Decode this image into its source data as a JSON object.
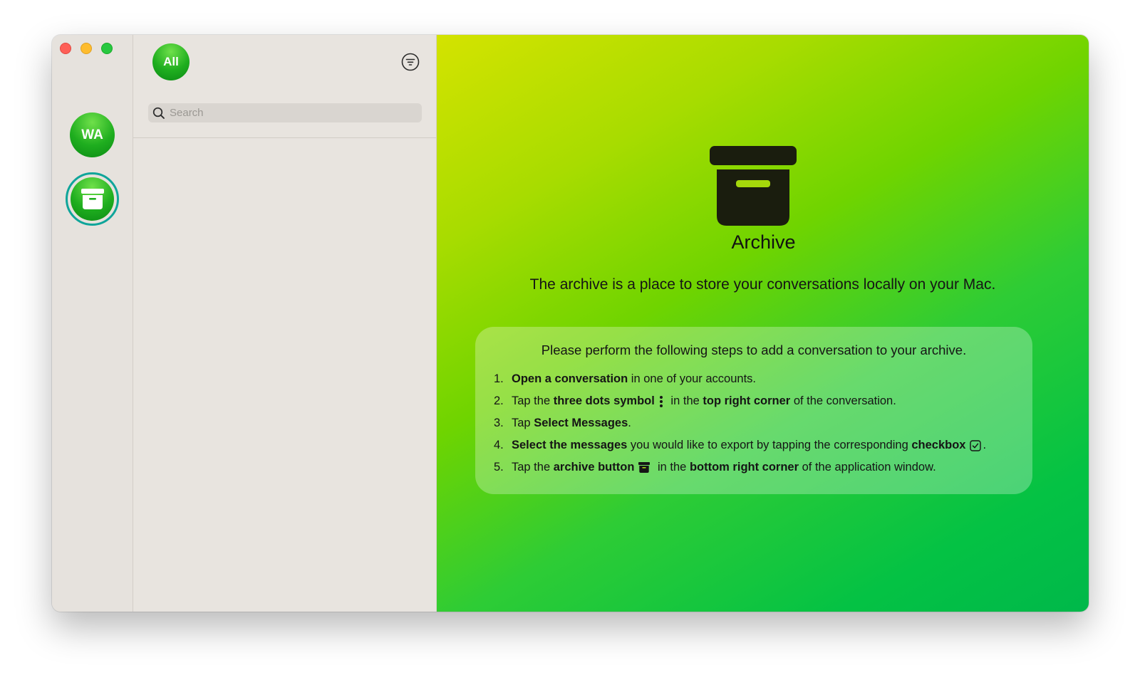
{
  "accounts": {
    "wa_label": "WA"
  },
  "list": {
    "all_label": "All",
    "search_placeholder": "Search"
  },
  "archive": {
    "title": "Archive",
    "subtitle": "The archive is a place to store your conversations locally on your Mac.",
    "steps_heading": "Please perform the following steps to add a conversation to your archive.",
    "steps": [
      {
        "num": "1.",
        "b1": "Open a conversation",
        "t1": " in one of your accounts."
      },
      {
        "num": "2.",
        "t0": "Tap the ",
        "b1": "three dots symbol",
        "t1": " in the ",
        "b2": "top right corner",
        "t2": " of the conversation."
      },
      {
        "num": "3.",
        "t0": "Tap ",
        "b1": "Select Messages",
        "t1": "."
      },
      {
        "num": "4.",
        "b1": "Select the messages",
        "t1": " you would like to export by tapping the corresponding ",
        "b2": "checkbox",
        "t2": "."
      },
      {
        "num": "5.",
        "t0": "Tap the ",
        "b1": "archive button",
        "t1": " in the ",
        "b2": "bottom right corner",
        "t2": " of the application window."
      }
    ]
  },
  "colors": {
    "close": "#fe5f57",
    "minimize": "#febc2e",
    "maximize": "#28c840",
    "accent_green": "#1fae1f",
    "selected_ring": "#0fa59a",
    "icon_dark": "#1a1d0e"
  },
  "icons": {
    "filter": "filter-lines-icon",
    "search": "magnifier-icon",
    "archive": "archive-box-icon",
    "dots": "vertical-ellipsis-icon",
    "checkbox": "checkbox-icon"
  }
}
